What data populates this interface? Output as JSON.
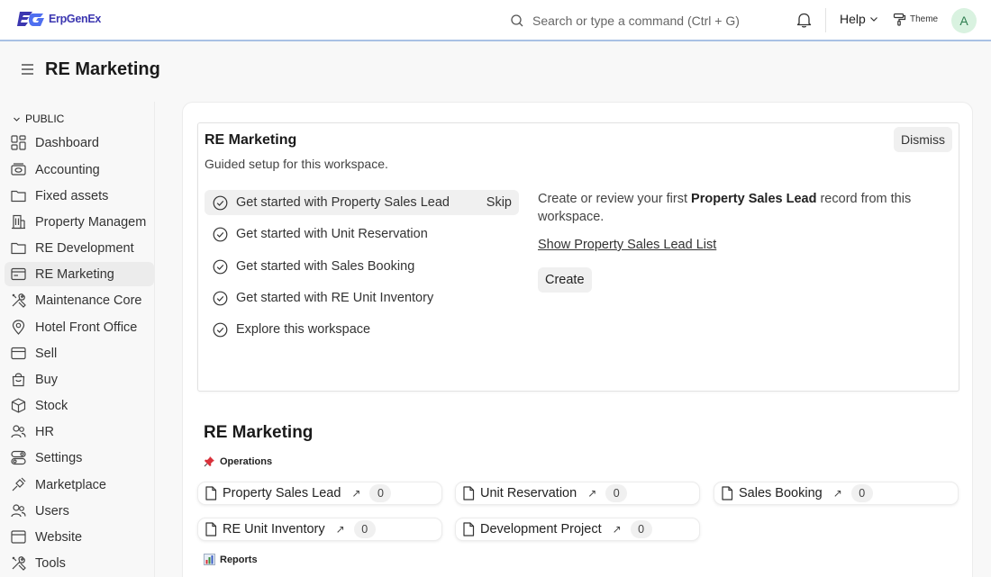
{
  "app": {
    "brand": "ErpGenEx",
    "avatar_letter": "A"
  },
  "navbar": {
    "search_placeholder": "Search or type a command (Ctrl + G)",
    "help_label": "Help",
    "theme_label": "Theme"
  },
  "page": {
    "title": "RE Marketing"
  },
  "sidebar": {
    "section": "PUBLIC",
    "items": [
      {
        "label": "Dashboard",
        "icon": "dashboard-icon"
      },
      {
        "label": "Accounting",
        "icon": "accounting-icon"
      },
      {
        "label": "Fixed assets",
        "icon": "folder-icon"
      },
      {
        "label": "Property Managem",
        "icon": "building-icon"
      },
      {
        "label": "RE Development",
        "icon": "folder-icon"
      },
      {
        "label": "RE Marketing",
        "icon": "card-icon",
        "active": true
      },
      {
        "label": "Maintenance Core",
        "icon": "tools-icon"
      },
      {
        "label": "Hotel Front Office",
        "icon": "location-icon"
      },
      {
        "label": "Sell",
        "icon": "sell-icon"
      },
      {
        "label": "Buy",
        "icon": "bag-icon"
      },
      {
        "label": "Stock",
        "icon": "box-icon"
      },
      {
        "label": "HR",
        "icon": "people-icon"
      },
      {
        "label": "Settings",
        "icon": "settings-icon"
      },
      {
        "label": "Marketplace",
        "icon": "marketplace-icon"
      },
      {
        "label": "Users",
        "icon": "users-icon"
      },
      {
        "label": "Website",
        "icon": "website-icon"
      },
      {
        "label": "Tools",
        "icon": "tools-icon"
      }
    ]
  },
  "onboarding": {
    "title": "RE Marketing",
    "subtitle": "Guided setup for this workspace.",
    "dismiss_label": "Dismiss",
    "skip_label": "Skip",
    "steps": [
      "Get started with Property Sales Lead",
      "Get started with Unit Reservation",
      "Get started with Sales Booking",
      "Get started with RE Unit Inventory",
      "Explore this workspace"
    ],
    "description_pre": "Create or review your first ",
    "description_bold": "Property Sales Lead",
    "description_post": " record from this workspace.",
    "link_label": "Show Property Sales Lead List",
    "create_label": "Create"
  },
  "workspace": {
    "title": "RE Marketing",
    "groups": {
      "operations": "Operations",
      "reports": "Reports"
    },
    "shortcuts": [
      {
        "label": "Property Sales Lead",
        "count": "0"
      },
      {
        "label": "Unit Reservation",
        "count": "0"
      },
      {
        "label": "Sales Booking",
        "count": "0"
      },
      {
        "label": "RE Unit Inventory",
        "count": "0"
      },
      {
        "label": "Development Project",
        "count": "0"
      }
    ]
  },
  "colors": {
    "accent": "#3b36b0",
    "navbar_border": "#a9c1e4",
    "avatar_bg": "#d9f2e0"
  }
}
